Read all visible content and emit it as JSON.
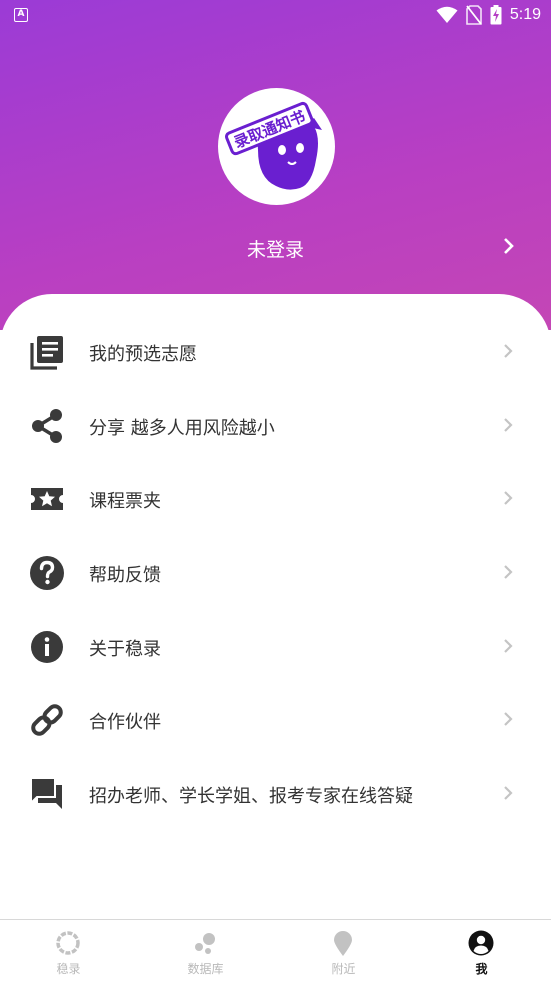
{
  "status_bar": {
    "app_icon_letter": "A",
    "time": "5:19"
  },
  "profile": {
    "avatar_text": "录取通知书",
    "login_label": "未登录"
  },
  "menu": [
    {
      "label": "我的预选志愿",
      "icon": "list-document-icon"
    },
    {
      "label": "分享 越多人用风险越小",
      "icon": "share-icon"
    },
    {
      "label": "课程票夹",
      "icon": "ticket-star-icon"
    },
    {
      "label": "帮助反馈",
      "icon": "help-circle-icon"
    },
    {
      "label": "关于稳录",
      "icon": "info-icon"
    },
    {
      "label": "合作伙伴",
      "icon": "link-icon"
    },
    {
      "label": "招办老师、学长学姐、报考专家在线答疑",
      "icon": "chat-icon"
    }
  ],
  "tabs": [
    {
      "label": "稳录",
      "icon": "ring-icon",
      "active": false
    },
    {
      "label": "数据库",
      "icon": "bubbles-icon",
      "active": false
    },
    {
      "label": "附近",
      "icon": "location-pin-icon",
      "active": false
    },
    {
      "label": "我",
      "icon": "user-icon",
      "active": true
    }
  ],
  "colors": {
    "header_start": "#9b3bd6",
    "header_end": "#c446b5",
    "icon_dark": "#3a3a3a",
    "chevron": "#c4c4c4",
    "tab_inactive": "#b8b8b8",
    "tab_active": "#111111"
  }
}
